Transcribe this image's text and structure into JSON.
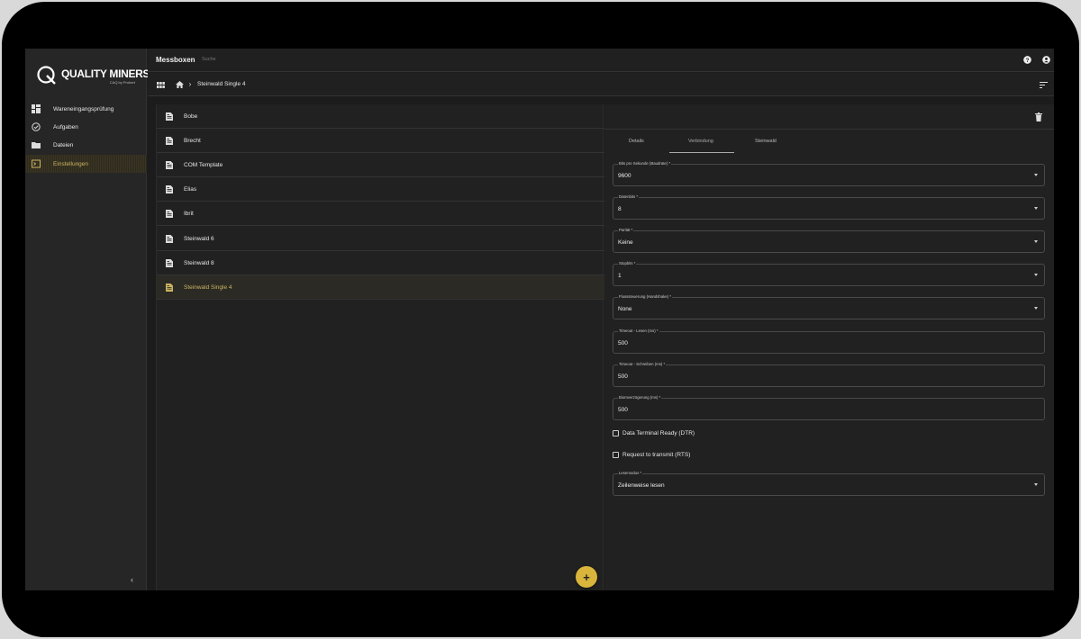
{
  "brand": {
    "name": "QUALITY MINERS",
    "sub": "CAQ by Probert",
    "accent": "#d9b53c"
  },
  "header": {
    "title": "Messboxen",
    "search_label": "Suche"
  },
  "sidebar": {
    "items": [
      {
        "label": "Wareneingangsprüfung",
        "icon": "dashboard-icon"
      },
      {
        "label": "Aufgaben",
        "icon": "check-circle-icon"
      },
      {
        "label": "Dateien",
        "icon": "folder-icon"
      },
      {
        "label": "Einstellungen",
        "icon": "settings-box-icon",
        "active": true
      }
    ]
  },
  "breadcrumb": {
    "current": "Steinwald Single 4"
  },
  "list": {
    "items": [
      "Bobe",
      "Brecht",
      "COM Template",
      "Elias",
      "Ibrit",
      "Steinwald 6",
      "Steinwald 8",
      "Steinwald Single 4"
    ],
    "selected_index": 7
  },
  "detail": {
    "tabs": [
      "Details",
      "Verbindung",
      "Steinwald"
    ],
    "active_tab": "Verbindung",
    "fields": [
      {
        "label": "Bits pro Sekunde (Baudrate) *",
        "value": "9600",
        "select": true
      },
      {
        "label": "Datenbits *",
        "value": "8",
        "select": true
      },
      {
        "label": "Parität *",
        "value": "Keine",
        "select": true
      },
      {
        "label": "Stopbits *",
        "value": "1",
        "select": true
      },
      {
        "label": "Flusssteuerung (Handshake) *",
        "value": "None",
        "select": true
      },
      {
        "label": "Timeout - Lesen (ms) *",
        "value": "500",
        "select": false
      },
      {
        "label": "Timeout - Schreiben (ms) *",
        "value": "500",
        "select": false
      },
      {
        "label": "Biomverzögerung (ms) *",
        "value": "500",
        "select": false
      }
    ],
    "checkboxes": [
      {
        "label": "Data Terminal Ready (DTR)",
        "checked": false
      },
      {
        "label": "Request to transmit (RTS)",
        "checked": false
      }
    ],
    "read_mode": {
      "label": "Lesemodus *",
      "value": "Zeilenweise lesen"
    }
  }
}
